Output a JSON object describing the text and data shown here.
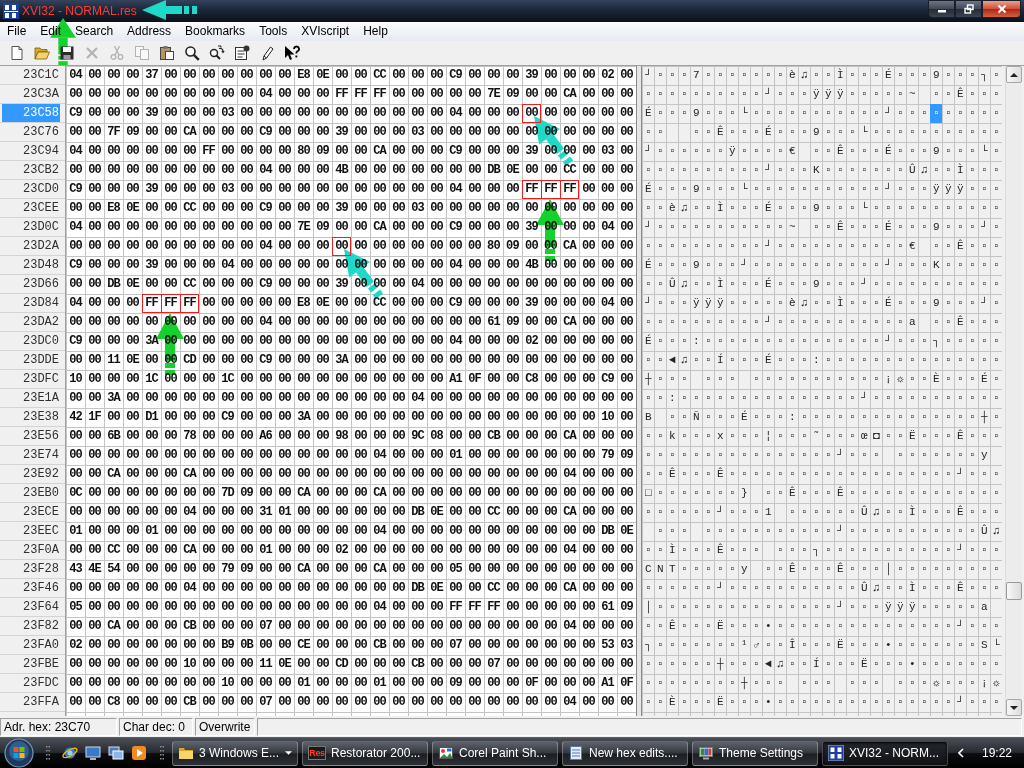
{
  "window": {
    "title": "XVI32 - NORMAL.res",
    "annotations": [
      {
        "kind": "left",
        "color": "#1ed8c8"
      },
      {
        "kind": "up",
        "color": "#15d12d"
      }
    ]
  },
  "menu": [
    "File",
    "Edit",
    "Search",
    "Address",
    "Bookmarks",
    "Tools",
    "XVIscript",
    "Help"
  ],
  "toolbar": [
    {
      "kind": "new",
      "disabled": false
    },
    {
      "kind": "open",
      "disabled": false
    },
    {
      "kind": "save",
      "disabled": false
    },
    {
      "kind": "delete",
      "disabled": true
    },
    {
      "kind": "cut",
      "disabled": true
    },
    {
      "kind": "copy",
      "disabled": true
    },
    {
      "kind": "paste",
      "disabled": false
    },
    {
      "kind": "find",
      "disabled": false
    },
    {
      "kind": "replace",
      "disabled": false
    },
    {
      "kind": "properties",
      "disabled": false
    },
    {
      "kind": "script",
      "disabled": false
    },
    {
      "kind": "help",
      "disabled": false
    }
  ],
  "hex_view": {
    "rows": [
      {
        "address": "23C1C",
        "selected": false,
        "hex": [
          {
            "bytes": "04 00 00 00 37 00 00 00 00 00 00 00 E8 0E 00 00 CC 00 00 00 C9 00 00 00 39 00 00 00 02 00",
            "marked": false
          }
        ],
        "chars": [
          {
            "text": "┘ ▫ ▫ ▫ 7 ▫ ▫ ▫ ▫ ▫ ▫ ▫ è ♫ ▫ ▫ Ì ▫ ▫ ▫ É ▫ ▫ ▫ 9 ▫ ▫ ▫ ┐ ▫",
            "cursor": false
          }
        ]
      },
      {
        "address": "23C3A",
        "selected": false,
        "hex": [
          {
            "bytes": "00 00 00 00 00 00 00 00 00 00 04 00 00 00 FF FF FF 00 00 00 00 00 7E 09 00 00 CA 00 00 00",
            "marked": false
          }
        ],
        "chars": [
          {
            "text": "▫ ▫ ▫ ▫ ▫ ▫ ▫ ▫ ▫ ▫ ┘ ▫ ▫ ▫ ÿ ÿ ÿ ▫ ▫ ▫ ▫ ▫ ~   ▫ ▫ Ê ▫ ▫ ▫",
            "cursor": false
          }
        ]
      },
      {
        "address": "23C58",
        "selected": true,
        "hex": [
          {
            "bytes": "C9 00 00 00 39 00 00 00 03 00 00 00 00 00 00 00 00 00 00 00 04 00 00 00",
            "marked": false
          },
          {
            "bytes": "00",
            "marked": true,
            "annotation": {
              "kind": "diagonal",
              "color": "#1ed8c8"
            }
          },
          {
            "bytes": "00 00 00 00 00",
            "marked": false
          }
        ],
        "chars": [
          {
            "text": "É ▫ ▫ ▫ 9 ▫ ▫ ▫ └ ▫ ▫ ▫ ▫ ▫ ▫ ▫ ▫ ▫ ▫ ▫ ┘ ▫ ▫ ▫",
            "cursor": false
          },
          {
            "text": "▫",
            "cursor": true
          },
          {
            "text": "▫ ▫ ▫ ▫ ▫",
            "cursor": false
          }
        ]
      },
      {
        "address": "23C76",
        "selected": false,
        "hex": [
          {
            "bytes": "00 00 7F 09 00 00 CA 00 00 00 C9 00 00 00 39 00 00 00 03 00 00 00 00 00 00 00 00 00 00 00",
            "marked": false
          }
        ],
        "chars": [
          {
            "text": "▫ ▫     ▫ ▫ Ê ▫ ▫ ▫ É ▫ ▫ ▫ 9 ▫ ▫ ▫ └ ▫ ▫ ▫ ▫ ▫ ▫ ▫ ▫ ▫ ▫ ▫",
            "cursor": false
          }
        ]
      },
      {
        "address": "23C94",
        "selected": false,
        "hex": [
          {
            "bytes": "04 00 00 00 00 00 00 FF 00 00 00 00 80 09 00 00 CA 00 00 00 C9 00 00 00 39 00 00 00 03 00",
            "marked": false
          }
        ],
        "chars": [
          {
            "text": "┘ ▫ ▫ ▫ ▫ ▫ ▫ ÿ ▫ ▫ ▫ ▫ €   ▫ ▫ Ê ▫ ▫ ▫ É ▫ ▫ ▫ 9 ▫ ▫ ▫ └ ▫",
            "cursor": false
          }
        ]
      },
      {
        "address": "23CB2",
        "selected": false,
        "hex": [
          {
            "bytes": "00 00 00 00 00 00 00 00 00 00 04 00 00 00 4B 00 00 00 00 00 00 00 DB 0E 00 00 CC 00 00 00",
            "marked": false
          }
        ],
        "chars": [
          {
            "text": "▫ ▫ ▫ ▫ ▫ ▫ ▫ ▫ ▫ ▫ ┘ ▫ ▫ ▫ K ▫ ▫ ▫ ▫ ▫ ▫ ▫ Û ♫ ▫ ▫ Ì ▫ ▫ ▫",
            "cursor": false
          }
        ]
      },
      {
        "address": "23CD0",
        "selected": false,
        "hex": [
          {
            "bytes": "C9 00 00 00 39 00 00 00 03 00 00 00 00 00 00 00 00 00 00 00 04 00 00 00",
            "marked": false
          },
          {
            "bytes": "FF FF FF",
            "marked": true,
            "annotation": {
              "kind": "up",
              "color": "#15d12d"
            }
          },
          {
            "bytes": "00 00 00",
            "marked": false
          }
        ],
        "chars": [
          {
            "text": "É ▫ ▫ ▫ 9 ▫ ▫ ▫ └ ▫ ▫ ▫ ▫ ▫ ▫ ▫ ▫ ▫ ▫ ▫ ┘ ▫ ▫ ▫ ÿ ÿ ÿ ▫ ▫ ▫",
            "cursor": false
          }
        ]
      },
      {
        "address": "23CEE",
        "selected": false,
        "hex": [
          {
            "bytes": "00 00 E8 0E 00 00 CC 00 00 00 C9 00 00 00 39 00 00 00 03 00 00 00 00 00 00 00 00 00 00 00",
            "marked": false
          }
        ],
        "chars": [
          {
            "text": "▫ ▫ è ♫ ▫ ▫ Ì ▫ ▫ ▫ É ▫ ▫ ▫ 9 ▫ ▫ ▫ └ ▫ ▫ ▫ ▫ ▫ ▫ ▫ ▫ ▫ ▫ ▫",
            "cursor": false
          }
        ]
      },
      {
        "address": "23D0C",
        "selected": false,
        "hex": [
          {
            "bytes": "04 00 00 00 00 00 00 00 00 00 00 00 7E 09 00 00 CA 00 00 00 C9 00 00 00 39 00 00 00 04 00",
            "marked": false
          }
        ],
        "chars": [
          {
            "text": "┘ ▫ ▫ ▫ ▫ ▫ ▫ ▫ ▫ ▫ ▫ ▫ ~   ▫ ▫ Ê ▫ ▫ ▫ É ▫ ▫ ▫ 9 ▫ ▫ ▫ ┘ ▫",
            "cursor": false
          }
        ]
      },
      {
        "address": "23D2A",
        "selected": false,
        "hex": [
          {
            "bytes": "00 00 00 00 00 00 00 00 00 00 04 00 00 00",
            "marked": false
          },
          {
            "bytes": "00",
            "marked": true,
            "annotation": {
              "kind": "diagonal",
              "color": "#1ed8c8"
            }
          },
          {
            "bytes": "00 00 00 00 00 00 00 80 09 00 00 CA 00 00 00",
            "marked": false
          }
        ],
        "chars": [
          {
            "text": "▫ ▫ ▫ ▫ ▫ ▫ ▫ ▫ ▫ ▫ ┘ ▫ ▫ ▫ ▫ ▫ ▫ ▫ ▫ ▫ ▫ ▫ €   ▫ ▫ Ê ▫ ▫ ▫",
            "cursor": false
          }
        ]
      },
      {
        "address": "23D48",
        "selected": false,
        "hex": [
          {
            "bytes": "C9 00 00 00 39 00 00 00 04 00 00 00 00 00 00 00 00 00 00 00 04 00 00 00 4B 00 00 00 00 00",
            "marked": false
          }
        ],
        "chars": [
          {
            "text": "É ▫ ▫ ▫ 9 ▫ ▫ ▫ ┘ ▫ ▫ ▫ ▫ ▫ ▫ ▫ ▫ ▫ ▫ ▫ ┘ ▫ ▫ ▫ K ▫ ▫ ▫ ▫ ▫",
            "cursor": false
          }
        ]
      },
      {
        "address": "23D66",
        "selected": false,
        "hex": [
          {
            "bytes": "00 00 DB 0E 00 00 CC 00 00 00 C9 00 00 00 39 00 00 00 04 00 00 00 00 00 00 00 00 00 00 00",
            "marked": false
          }
        ],
        "chars": [
          {
            "text": "▫ ▫ Û ♫ ▫ ▫ Ì ▫ ▫ ▫ É ▫ ▫ ▫ 9 ▫ ▫ ▫ ┘ ▫ ▫ ▫ ▫ ▫ ▫ ▫ ▫ ▫ ▫ ▫",
            "cursor": false
          }
        ]
      },
      {
        "address": "23D84",
        "selected": false,
        "hex": [
          {
            "bytes": "04 00 00 00",
            "marked": false
          },
          {
            "bytes": "FF FF FF",
            "marked": true,
            "annotation": {
              "kind": "up",
              "color": "#15d12d"
            }
          },
          {
            "bytes": "00 00 00 00 00 E8 0E 00 00 CC 00 00 00 C9 00 00 00 39 00 00 00 04 00",
            "marked": false
          }
        ],
        "chars": [
          {
            "text": "┘ ▫ ▫ ▫ ÿ ÿ ÿ ▫ ▫ ▫ ▫ ▫ è ♫ ▫ ▫ Ì ▫ ▫ ▫ É ▫ ▫ ▫ 9 ▫ ▫ ▫ ┘ ▫",
            "cursor": false
          }
        ]
      },
      {
        "address": "23DA2",
        "selected": false,
        "hex": [
          {
            "bytes": "00 00 00 00 00 00 00 00 00 00 04 00 00 00 00 00 00 00 00 00 00 00 61 09 00 00 CA 00 00 00",
            "marked": false
          }
        ],
        "chars": [
          {
            "text": "▫ ▫ ▫ ▫ ▫ ▫ ▫ ▫ ▫ ▫ ┘ ▫ ▫ ▫ ▫ ▫ ▫ ▫ ▫ ▫ ▫ ▫ a   ▫ ▫ Ê ▫ ▫ ▫",
            "cursor": false
          }
        ]
      },
      {
        "address": "23DC0",
        "selected": false,
        "hex": [
          {
            "bytes": "C9 00 00 00 3A 00 00 00 00 00 00 00 00 00 00 00 00 00 00 00 04 00 00 00 02 00 00 00 00 00",
            "marked": false
          }
        ],
        "chars": [
          {
            "text": "É ▫ ▫ ▫ : ▫ ▫ ▫ ▫ ▫ ▫ ▫ ▫ ▫ ▫ ▫ ▫ ▫ ▫ ▫ ┘ ▫ ▫ ▫ ┐ ▫ ▫ ▫ ▫ ▫",
            "cursor": false
          }
        ]
      },
      {
        "address": "23DDE",
        "selected": false,
        "hex": [
          {
            "bytes": "00 00 11 0E 00 00 CD 00 00 00 C9 00 00 00 3A 00 00 00 00 00 00 00 00 00 00 00 00 00 00 00",
            "marked": false
          }
        ],
        "chars": [
          {
            "text": "▫ ▫ ◄ ♫ ▫ ▫ Í ▫ ▫ ▫ É ▫ ▫ ▫ : ▫ ▫ ▫ ▫ ▫ ▫ ▫ ▫ ▫ ▫ ▫ ▫ ▫ ▫ ▫",
            "cursor": false
          }
        ]
      },
      {
        "address": "23DFC",
        "selected": false,
        "hex": [
          {
            "bytes": "10 00 00 00 1C 00 00 00 1C 00 00 00 00 00 00 00 00 00 00 00 A1 0F 00 00 C8 00 00 00 C9 00",
            "marked": false
          }
        ],
        "chars": [
          {
            "text": "┼ ▫ ▫ ▫   ▫ ▫ ▫   ▫ ▫ ▫ ▫ ▫ ▫ ▫ ▫ ▫ ▫ ▫ ¡ ☼ ▫ ▫ È ▫ ▫ ▫ É ▫",
            "cursor": false
          }
        ]
      },
      {
        "address": "23E1A",
        "selected": false,
        "hex": [
          {
            "bytes": "00 00 3A 00 00 00 00 00 00 00 00 00 00 00 00 00 00 00 04 00 00 00 00 00 00 00 00 00 00 00",
            "marked": false
          }
        ],
        "chars": [
          {
            "text": "▫ ▫ : ▫ ▫ ▫ ▫ ▫ ▫ ▫ ▫ ▫ ▫ ▫ ▫ ▫ ▫ ▫ ┘ ▫ ▫ ▫ ▫ ▫ ▫ ▫ ▫ ▫ ▫ ▫",
            "cursor": false
          }
        ]
      },
      {
        "address": "23E38",
        "selected": false,
        "hex": [
          {
            "bytes": "42 1F 00 00 D1 00 00 00 C9 00 00 00 3A 00 00 00 00 00 00 00 00 00 00 00 00 00 00 00 10 00",
            "marked": false
          }
        ],
        "chars": [
          {
            "text": "B   ▫ ▫ Ñ ▫ ▫ ▫ É ▫ ▫ ▫ : ▫ ▫ ▫ ▫ ▫ ▫ ▫ ▫ ▫ ▫ ▫ ▫ ▫ ▫ ▫ ┼ ▫",
            "cursor": false
          }
        ]
      },
      {
        "address": "23E56",
        "selected": false,
        "hex": [
          {
            "bytes": "00 00 6B 00 00 00 78 00 00 00 A6 00 00 00 98 00 00 00 9C 08 00 00 CB 00 00 00 CA 00 00 00",
            "marked": false
          }
        ],
        "chars": [
          {
            "text": "▫ ▫ k ▫ ▫ ▫ x ▫ ▫ ▫ ¦ ▫ ▫ ▫ ˜ ▫ ▫ ▫ œ ◘ ▫ ▫ Ë ▫ ▫ ▫ Ê ▫ ▫ ▫",
            "cursor": false
          }
        ]
      },
      {
        "address": "23E74",
        "selected": false,
        "hex": [
          {
            "bytes": "00 00 00 00 00 00 00 00 00 00 00 00 00 00 00 00 04 00 00 00 01 00 00 00 00 00 00 00 79 09",
            "marked": false
          }
        ],
        "chars": [
          {
            "text": "▫ ▫ ▫ ▫ ▫ ▫ ▫ ▫ ▫ ▫ ▫ ▫ ▫ ▫ ▫ ▫ ┘ ▫ ▫ ▫   ▫ ▫ ▫ ▫ ▫ ▫ ▫ y  ",
            "cursor": false
          }
        ]
      },
      {
        "address": "23E92",
        "selected": false,
        "hex": [
          {
            "bytes": "00 00 CA 00 00 00 CA 00 00 00 00 00 00 00 00 00 00 00 00 00 00 00 00 00 00 00 04 00 00 00",
            "marked": false
          }
        ],
        "chars": [
          {
            "text": "▫ ▫ Ê ▫ ▫ ▫ Ê ▫ ▫ ▫ ▫ ▫ ▫ ▫ ▫ ▫ ▫ ▫ ▫ ▫ ▫ ▫ ▫ ▫ ▫ ▫ ┘ ▫ ▫ ▫",
            "cursor": false
          }
        ]
      },
      {
        "address": "23EB0",
        "selected": false,
        "hex": [
          {
            "bytes": "0C 00 00 00 00 00 00 00 7D 09 00 00 CA 00 00 00 CA 00 00 00 00 00 00 00 00 00 00 00 00 00",
            "marked": false
          }
        ],
        "chars": [
          {
            "text": "□ ▫ ▫ ▫ ▫ ▫ ▫ ▫ }   ▫ ▫ Ê ▫ ▫ ▫ Ê ▫ ▫ ▫ ▫ ▫ ▫ ▫ ▫ ▫ ▫ ▫ ▫ ▫",
            "cursor": false
          }
        ]
      },
      {
        "address": "23ECE",
        "selected": false,
        "hex": [
          {
            "bytes": "00 00 00 00 00 00 04 00 00 00 31 01 00 00 00 00 00 00 DB 0E 00 00 CC 00 00 00 CA 00 00 00",
            "marked": false
          }
        ],
        "chars": [
          {
            "text": "▫ ▫ ▫ ▫ ▫ ▫ ┘ ▫ ▫ ▫ 1   ▫ ▫ ▫ ▫ ▫ ▫ Û ♫ ▫ ▫ Ì ▫ ▫ ▫ Ê ▫ ▫ ▫",
            "cursor": false
          }
        ]
      },
      {
        "address": "23EEC",
        "selected": false,
        "hex": [
          {
            "bytes": "01 00 00 00 01 00 00 00 00 00 00 00 00 00 00 00 04 00 00 00 00 00 00 00 00 00 00 00 DB 0E",
            "marked": false
          }
        ],
        "chars": [
          {
            "text": "  ▫ ▫ ▫   ▫ ▫ ▫ ▫ ▫ ▫ ▫ ▫ ▫ ▫ ▫ ┘ ▫ ▫ ▫ ▫ ▫ ▫ ▫ ▫ ▫ ▫ ▫ Û ♫",
            "cursor": false
          }
        ]
      },
      {
        "address": "23F0A",
        "selected": false,
        "hex": [
          {
            "bytes": "00 00 CC 00 00 00 CA 00 00 00 01 00 00 00 02 00 00 00 00 00 00 00 00 00 00 00 04 00 00 00",
            "marked": false
          }
        ],
        "chars": [
          {
            "text": "▫ ▫ Ì ▫ ▫ ▫ Ê ▫ ▫ ▫   ▫ ▫ ▫ ┐ ▫ ▫ ▫ ▫ ▫ ▫ ▫ ▫ ▫ ▫ ▫ ┘ ▫ ▫ ▫",
            "cursor": false
          }
        ]
      },
      {
        "address": "23F28",
        "selected": false,
        "hex": [
          {
            "bytes": "43 4E 54 00 00 00 00 00 79 09 00 00 CA 00 00 00 CA 00 00 00 05 00 00 00 00 00 00 00 00 00",
            "marked": false
          }
        ],
        "chars": [
          {
            "text": "C N T ▫ ▫ ▫ ▫ ▫ y   ▫ ▫ Ê ▫ ▫ ▫ Ê ▫ ▫ ▫ │ ▫ ▫ ▫ ▫ ▫ ▫ ▫ ▫ ▫",
            "cursor": false
          }
        ]
      },
      {
        "address": "23F46",
        "selected": false,
        "hex": [
          {
            "bytes": "00 00 00 00 00 00 04 00 00 00 00 00 00 00 00 00 00 00 DB 0E 00 00 CC 00 00 00 CA 00 00 00",
            "marked": false
          }
        ],
        "chars": [
          {
            "text": "▫ ▫ ▫ ▫ ▫ ▫ ┘ ▫ ▫ ▫ ▫ ▫ ▫ ▫ ▫ ▫ ▫ ▫ Û ♫ ▫ ▫ Ì ▫ ▫ ▫ Ê ▫ ▫ ▫",
            "cursor": false
          }
        ]
      },
      {
        "address": "23F64",
        "selected": false,
        "hex": [
          {
            "bytes": "05 00 00 00 00 00 00 00 00 00 00 00 00 00 00 00 04 00 00 00 FF FF FF 00 00 00 00 00 61 09",
            "marked": false
          }
        ],
        "chars": [
          {
            "text": "│ ▫ ▫ ▫ ▫ ▫ ▫ ▫ ▫ ▫ ▫ ▫ ▫ ▫ ▫ ▫ ┘ ▫ ▫ ▫ ÿ ÿ ÿ ▫ ▫ ▫ ▫ ▫ a  ",
            "cursor": false
          }
        ]
      },
      {
        "address": "23F82",
        "selected": false,
        "hex": [
          {
            "bytes": "00 00 CA 00 00 00 CB 00 00 00 07 00 00 00 00 00 00 00 00 00 00 00 00 00 00 00 04 00 00 00",
            "marked": false
          }
        ],
        "chars": [
          {
            "text": "▫ ▫ Ê ▫ ▫ ▫ Ë ▫ ▫ ▫ • ▫ ▫ ▫ ▫ ▫ ▫ ▫ ▫ ▫ ▫ ▫ ▫ ▫ ▫ ▫ ┘ ▫ ▫ ▫",
            "cursor": false
          }
        ]
      },
      {
        "address": "23FA0",
        "selected": false,
        "hex": [
          {
            "bytes": "02 00 00 00 00 00 00 00 B9 0B 00 00 CE 00 00 00 CB 00 00 00 07 00 00 00 00 00 00 00 53 03",
            "marked": false
          }
        ],
        "chars": [
          {
            "text": "┐ ▫ ▫ ▫ ▫ ▫ ▫ ▫ ¹ ♂ ▫ ▫ Î ▫ ▫ ▫ Ë ▫ ▫ ▫ • ▫ ▫ ▫ ▫ ▫ ▫ ▫ S └",
            "cursor": false
          }
        ]
      },
      {
        "address": "23FBE",
        "selected": false,
        "hex": [
          {
            "bytes": "00 00 00 00 00 00 10 00 00 00 11 0E 00 00 CD 00 00 00 CB 00 00 00 07 00 00 00 00 00 00 00",
            "marked": false
          }
        ],
        "chars": [
          {
            "text": "▫ ▫ ▫ ▫ ▫ ▫ ┼ ▫ ▫ ▫ ◄ ♫ ▫ ▫ Í ▫ ▫ ▫ Ë ▫ ▫ ▫ • ▫ ▫ ▫ ▫ ▫ ▫ ▫",
            "cursor": false
          }
        ]
      },
      {
        "address": "23FDC",
        "selected": false,
        "hex": [
          {
            "bytes": "00 00 00 00 00 00 00 00 10 00 00 00 01 00 00 00 01 00 00 00 09 00 00 00 0F 00 00 00 A1 0F",
            "marked": false
          }
        ],
        "chars": [
          {
            "text": "▫ ▫ ▫ ▫ ▫ ▫ ▫ ▫ ┼ ▫ ▫ ▫   ▫ ▫ ▫   ▫ ▫ ▫   ▫ ▫ ▫ ☼ ▫ ▫ ▫ ¡ ☼",
            "cursor": false
          }
        ]
      },
      {
        "address": "23FFA",
        "selected": false,
        "hex": [
          {
            "bytes": "00 00 C8 00 00 00 CB 00 00 00 07 00 00 00 00 00 00 00 00 00 00 00 00 00 00 00 04 00 00 00",
            "marked": false
          }
        ],
        "chars": [
          {
            "text": "▫ ▫ È ▫ ▫ ▫ Ë ▫ ▫ ▫ • ▫ ▫ ▫ ▫ ▫ ▫ ▫ ▫ ▫ ▫ ▫ ▫ ▫ ▫ ▫ ┘ ▫ ▫ ▫",
            "cursor": false
          }
        ]
      }
    ]
  },
  "status_bar": [
    "Adr. hex: 23C70",
    "Char dec: 0",
    "Overwrite"
  ],
  "taskbar": {
    "quick_launch": [
      {
        "kind": "browser"
      },
      {
        "kind": "desktop"
      },
      {
        "kind": "switch"
      },
      {
        "kind": "player"
      }
    ],
    "tasks": [
      {
        "label": "3 Windows E...",
        "kind": "folder",
        "grouped": true,
        "selected": false
      },
      {
        "label": "Restorator 200...",
        "kind": "restorator",
        "badge": "Res",
        "grouped": false,
        "selected": false
      },
      {
        "label": "Corel Paint Sh...",
        "kind": "paint",
        "grouped": false,
        "selected": false
      },
      {
        "label": "New hex edits....",
        "kind": "notepad",
        "grouped": false,
        "selected": false
      },
      {
        "label": "Theme Settings",
        "kind": "display",
        "grouped": false,
        "selected": false
      },
      {
        "label": "XVI32 - NORM...",
        "kind": "hex-editor",
        "grouped": false,
        "selected": true
      }
    ],
    "clock": "19:22"
  }
}
